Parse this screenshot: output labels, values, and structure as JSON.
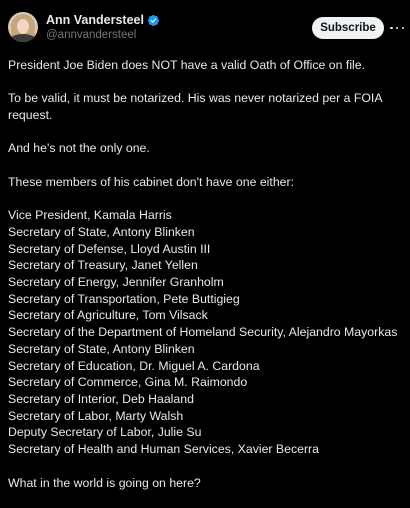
{
  "author": {
    "display_name": "Ann Vandersteel",
    "handle": "@annvandersteel",
    "verified": true,
    "avatar": "profile-photo-woman-blonde"
  },
  "actions": {
    "subscribe_label": "Subscribe",
    "more_icon": "ellipsis-icon"
  },
  "colors": {
    "background": "#000000",
    "text": "#e7e9ea",
    "secondary_text": "#71767b",
    "verified_badge": "#1d9bf0",
    "subscribe_bg": "#eff3f4"
  },
  "post": {
    "paragraph_1": "President Joe Biden does NOT have a valid Oath of Office on file.",
    "paragraph_2": "To be valid, it must be notarized. His was never notarized per a FOIA request.",
    "paragraph_3": "And he's not the only one.",
    "paragraph_4": "These members of his cabinet don't have one either:",
    "cabinet_list": [
      "Vice President, Kamala Harris",
      "Secretary of State, Antony Blinken",
      "Secretary of Defense, Lloyd Austin III",
      "Secretary of Treasury, Janet Yellen",
      "Secretary of Energy, Jennifer Granholm",
      "Secretary of Transportation, Pete Buttigieg",
      "Secretary of Agriculture, Tom Vilsack",
      "Secretary of the Department of Homeland Security, Alejandro Mayorkas",
      "Secretary of State, Antony Blinken",
      "Secretary of Education, Dr. Miguel A. Cardona",
      "Secretary of Commerce, Gina M. Raimondo",
      "Secretary of Interior, Deb Haaland",
      "Secretary of Labor, Marty Walsh",
      "Deputy Secretary of Labor, Julie Su",
      "Secretary of Health and Human Services, Xavier Becerra"
    ],
    "closing": "What in the world is going on here?"
  }
}
